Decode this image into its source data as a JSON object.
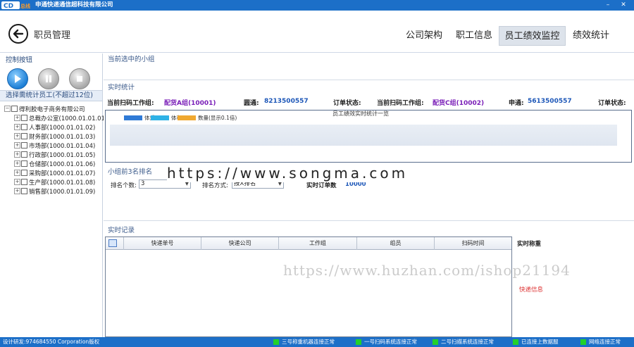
{
  "window": {
    "title": "申通快递通信超科技有限公司",
    "logo_text": "CD",
    "logo_sub": "总线",
    "minimize": "–",
    "close": "✕",
    "colors": {
      "titlebar": "#1c6fc8",
      "status_led": "#22d02a",
      "accent_text": "#1d57b8"
    }
  },
  "header": {
    "page_title": "职员管理",
    "tabs": [
      {
        "label": "公司架构"
      },
      {
        "label": "职工信息"
      },
      {
        "label": "员工绩效监控",
        "active": true
      },
      {
        "label": "绩效统计"
      }
    ]
  },
  "sidebar": {
    "control_label": "控制按钮",
    "buttons": [
      "play-icon",
      "pause-icon",
      "stop-icon"
    ],
    "select_label": "选择需统计员工(不超过12位)",
    "tree_root": "得利胶电子商务有限公司",
    "tree_children": [
      "总裁办公室(1000.01.01.01)",
      "人事部(1000.01.01.02)",
      "财务部(1000.01.01.03)",
      "市场部(1000.01.01.04)",
      "行政部(1000.01.01.05)",
      "仓储部(1000.01.01.06)",
      "采购部(1000.01.01.07)",
      "生产部(1000.01.01.08)",
      "销售部(1000.01.01.09)"
    ]
  },
  "main": {
    "current_group_label": "当前选中的小组",
    "realtime_label": "实时统计",
    "stats": {
      "scan_group_label": "当前扫码工作组:",
      "group_a": "配货A组(10001)",
      "yuantong_label": "圆通:",
      "yuantong_value": "8213500557",
      "order_status_label": "订单状态:",
      "scan_group_label_2": "当前扫码工作组:",
      "group_c": "配货C组(10002)",
      "shentong_label": "申通:",
      "shentong_value": "5613500557",
      "order_status_label_2": "订单状态:"
    },
    "chart": {
      "title": "员工绩效实时统计一览",
      "legend": [
        "体重",
        "体积",
        "数量(显示0.1倍)"
      ],
      "legend_colors": [
        "#2f7ad6",
        "#2fb2e6",
        "#f0a830"
      ]
    },
    "top3": {
      "label": "小组前3名排名",
      "rank_count_label": "排名个数:",
      "rank_count_value": "3",
      "sort_label": "排名方式:",
      "sort_value": "按X排名",
      "realtime_orders_label": "实时订单数",
      "realtime_orders_value": "10000"
    },
    "records": {
      "label": "实时记录",
      "columns": [
        "快递单号",
        "快递公司",
        "工作组",
        "组员",
        "扫码时间"
      ]
    },
    "right_info": {
      "realtime_weight": "实时称重",
      "express_info": "快递信息"
    },
    "watermarks": {
      "top": "https://www.songma.com",
      "bottom": "https://www.huzhan.com/ishop21194"
    }
  },
  "statusbar": {
    "left": "设计研发:974684550 Corporation版权",
    "items": [
      "三号称重机器连接正常",
      "一号扫码系统连接正常",
      "二号扫描系统连接正常",
      "已连接上数据服",
      "网络连接正常"
    ]
  }
}
